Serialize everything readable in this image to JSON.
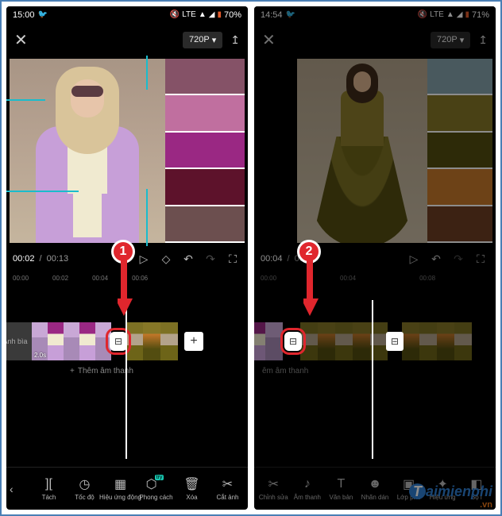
{
  "left": {
    "status": {
      "time": "15:00",
      "battery": "70%"
    },
    "header": {
      "quality": "720P"
    },
    "time": {
      "current": "00:02",
      "total": "00:13"
    },
    "ruler": [
      "00:00",
      "00:02",
      "00:04",
      "00:06"
    ],
    "cover_label": "Ảnh bìa",
    "clip_duration": "2.0s",
    "add_audio": "Thêm âm thanh",
    "toolbar": {
      "back": "‹",
      "items": [
        {
          "key": "split",
          "icon": "][",
          "label": "Tách"
        },
        {
          "key": "speed",
          "icon": "◷",
          "label": "Tốc độ"
        },
        {
          "key": "effect",
          "icon": "▦",
          "label": "Hiệu ứng động"
        },
        {
          "key": "style",
          "icon": "⬡",
          "label": "Phong cách",
          "badge": "try"
        },
        {
          "key": "delete",
          "icon": "🗑",
          "label": "Xóa"
        },
        {
          "key": "crop",
          "icon": "✂",
          "label": "Cắt ảnh"
        }
      ]
    },
    "palette": [
      "#855267",
      "#c06f9f",
      "#9a2883",
      "#5d122b",
      "#6c4f4f"
    ],
    "callout": "1"
  },
  "right": {
    "status": {
      "time": "14:54",
      "battery": "71%"
    },
    "header": {
      "quality": "720P"
    },
    "time": {
      "current": "00:04",
      "total": "00:14"
    },
    "ruler": [
      "00:00",
      "00:04",
      "00:08"
    ],
    "add_audio": "êm âm thanh",
    "toolbar": {
      "items": [
        {
          "key": "edit",
          "icon": "✂",
          "label": "Chỉnh sửa"
        },
        {
          "key": "audio",
          "icon": "♪",
          "label": "Âm thanh"
        },
        {
          "key": "text",
          "icon": "T",
          "label": "Văn bản"
        },
        {
          "key": "sticker",
          "icon": "☻",
          "label": "Nhãn dán"
        },
        {
          "key": "overlay",
          "icon": "▣",
          "label": "Lớp phủ"
        },
        {
          "key": "fx",
          "icon": "✦",
          "label": "Hiệu ứng"
        },
        {
          "key": "filter",
          "icon": "◧",
          "label": "Bộ l"
        }
      ]
    },
    "palette": [
      "#86a3ab",
      "#867727",
      "#534d10",
      "#c6782a",
      "#6e3f23"
    ],
    "callout": "2"
  },
  "watermark": {
    "brand": "aimienphi",
    "tld": ".vn"
  }
}
